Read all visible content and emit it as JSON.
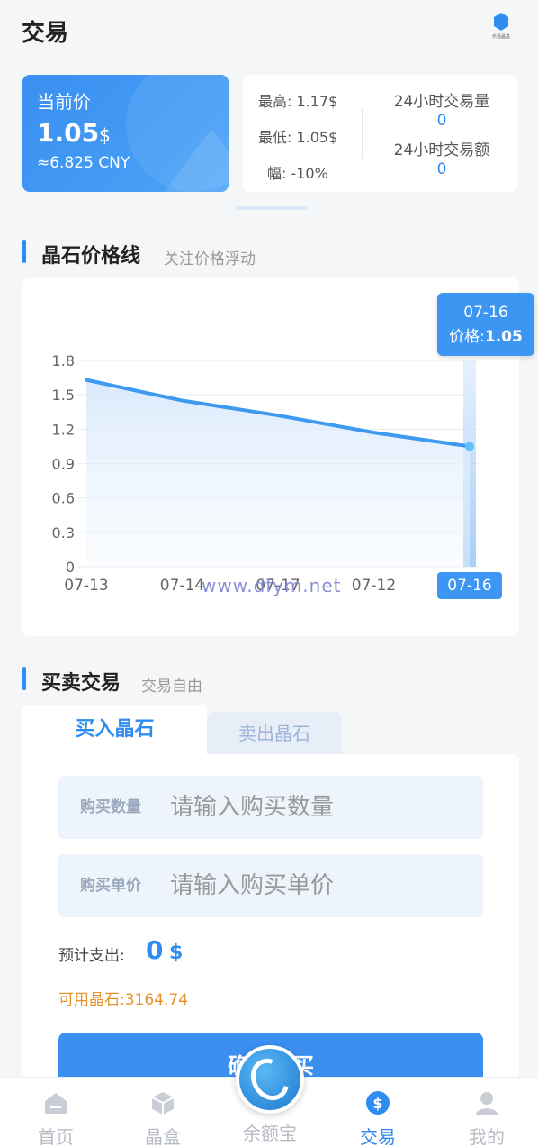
{
  "header": {
    "title": "交易",
    "logo_text": "乐活晶盒"
  },
  "price_card": {
    "label": "当前价",
    "value": "1.05",
    "unit": "$",
    "cny": "≈6.825 CNY"
  },
  "stats": {
    "high": "最高: 1.17$",
    "low": "最低: 1.05$",
    "change": "幅: -10%",
    "volume_label": "24小时交易量",
    "volume_value": "0",
    "amount_label": "24小时交易额",
    "amount_value": "0"
  },
  "price_section": {
    "title": "晶石价格线",
    "subtitle": "关注价格浮动"
  },
  "chart_data": {
    "type": "area",
    "x": [
      "07-13",
      "07-14",
      "07-17",
      "07-12",
      "07-16"
    ],
    "values": [
      1.63,
      1.45,
      1.32,
      1.17,
      1.05
    ],
    "ylim": [
      0,
      1.8
    ],
    "yticks": [
      "0",
      "0.3",
      "0.6",
      "0.9",
      "1.2",
      "1.5",
      "1.8"
    ],
    "grid": true,
    "line_color": "#3d9af0",
    "highlight_index": 4,
    "tooltip": {
      "date": "07-16",
      "label": "价格:",
      "value": "1.05"
    }
  },
  "watermark": "www.dfym.net",
  "trade_section": {
    "title": "买卖交易",
    "subtitle": "交易自由"
  },
  "tabs": {
    "buy": "买入晶石",
    "sell": "卖出晶石"
  },
  "form": {
    "qty_label": "购买数量",
    "qty_placeholder": "请输入购买数量",
    "price_label": "购买单价",
    "price_placeholder": "请输入购买单价",
    "estimate_label": "预计支出:",
    "estimate_value": "0",
    "estimate_unit": "$",
    "available": "可用晶石:3164.74",
    "confirm": "确认购买"
  },
  "tabbar": {
    "home": "首页",
    "box": "晶盒",
    "yuebao": "余额宝",
    "trade": "交易",
    "mine": "我的"
  },
  "colors": {
    "accent": "#2f8cf0",
    "warning": "#e8922a"
  }
}
